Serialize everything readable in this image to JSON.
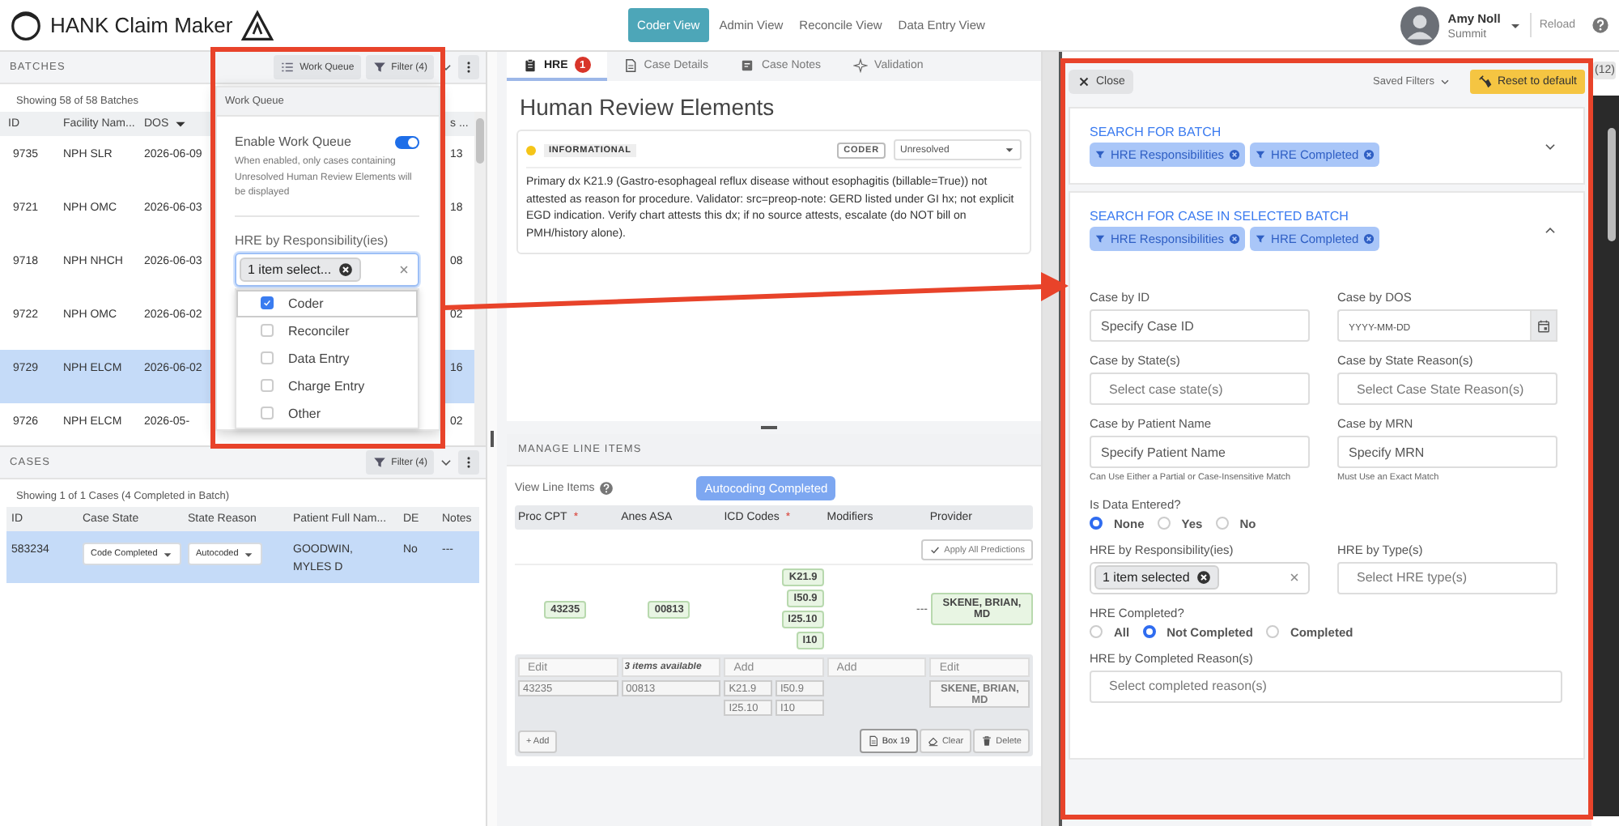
{
  "header": {
    "app_title": "HANK Claim Maker",
    "view_tabs": [
      {
        "label": "Coder View",
        "selected": true
      },
      {
        "label": "Admin View",
        "selected": false
      },
      {
        "label": "Reconcile View",
        "selected": false
      },
      {
        "label": "Data Entry View",
        "selected": false
      }
    ],
    "user": {
      "name": "Amy Noll",
      "org": "Summit"
    },
    "reload": "Reload"
  },
  "batches": {
    "title": "BATCHES",
    "work_queue_button": "Work Queue",
    "filter_button": "Filter (4)",
    "summary": "Showing 58 of 58 Batches",
    "columns": [
      "ID",
      "Facility Nam...",
      "DOS",
      "s ..."
    ],
    "rows": [
      {
        "cells": [
          "9735",
          "NPH SLR",
          "2026-06-09",
          "13"
        ],
        "selected": false
      },
      {
        "cells": [
          "9721",
          "NPH OMC",
          "2026-06-03",
          "18"
        ],
        "selected": false
      },
      {
        "cells": [
          "9718",
          "NPH NHCH",
          "2026-06-03",
          "08"
        ],
        "selected": false
      },
      {
        "cells": [
          "9722",
          "NPH OMC",
          "2026-06-02",
          "02"
        ],
        "selected": false
      },
      {
        "cells": [
          "9729",
          "NPH ELCM",
          "2026-06-02",
          "16"
        ],
        "selected": true
      },
      {
        "cells": [
          "9726",
          "NPH ELCM",
          "2026-05-",
          "02"
        ],
        "selected": false
      }
    ]
  },
  "work_queue_popup": {
    "title": "Work Queue",
    "toggle": {
      "label": "Enable Work Queue",
      "on": true
    },
    "description": "When enabled, only cases containing Unresolved Human Review Elements will be displayed",
    "responsibility": {
      "label": "HRE by Responsibility(ies)",
      "chip": "1 item select...",
      "options": [
        {
          "label": "Coder",
          "checked": true
        },
        {
          "label": "Reconciler",
          "checked": false
        },
        {
          "label": "Data Entry",
          "checked": false
        },
        {
          "label": "Charge Entry",
          "checked": false
        },
        {
          "label": "Other",
          "checked": false
        }
      ]
    }
  },
  "cases": {
    "title": "CASES",
    "filter_button": "Filter (4)",
    "summary": "Showing 1 of 1 Cases (4 Completed in Batch)",
    "columns": [
      "ID",
      "Case State",
      "State Reason",
      "Patient Full Nam...",
      "DE",
      "Notes"
    ],
    "rows": [
      {
        "id": "583234",
        "case_state": "Code Completed",
        "state_reason": "Autocoded",
        "patient": "GOODWIN, MYLES D",
        "de": "No",
        "notes": "---",
        "selected": true
      }
    ]
  },
  "case_tabs": [
    {
      "label": "HRE",
      "kind": "clipboard",
      "badge": "1",
      "selected": true
    },
    {
      "label": "Case Details",
      "kind": "document",
      "selected": false
    },
    {
      "label": "Case Notes",
      "kind": "note",
      "selected": false
    },
    {
      "label": "Validation",
      "kind": "sparkle",
      "selected": false
    }
  ],
  "hre": {
    "title": "Human Review Elements",
    "elements": [
      {
        "severity": "INFORMATIONAL",
        "color": "#f5c518",
        "responsibility": "CODER",
        "status": "Unresolved",
        "text": "Primary dx K21.9 (Gastro-esophageal reflux disease without esophagitis (billable=True)) not attested as reason for procedure. Validator: src=preop-note: GERD listed under GI hx; not explicit EGD indication. Verify chart attests this dx; if no source attests, escalate (do NOT bill on PMH/history alone)."
      }
    ]
  },
  "line_items": {
    "title": "MANAGE LINE ITEMS",
    "view_label": "View Line Items",
    "status_badge": "Autocoding Completed",
    "columns": [
      {
        "label": "Proc CPT",
        "marker": "*"
      },
      {
        "label": "Anes ASA"
      },
      {
        "label": "ICD Codes",
        "marker": "*"
      },
      {
        "label": "Modifiers"
      },
      {
        "label": "Provider"
      }
    ],
    "apply_button": "Apply All Predictions",
    "predictions": [
      {
        "chips": [
          "43235"
        ]
      },
      {
        "chips": [
          "00813"
        ]
      },
      {
        "chips": [
          "K21.9",
          "I50.9",
          "I25.10",
          "I10"
        ]
      },
      {
        "empty": "---"
      },
      {
        "chips": [
          "SKENE, BRIAN, MD"
        ]
      }
    ],
    "editors": [
      {
        "placeholder": "Edit",
        "emphasis": false,
        "values": [
          "43235"
        ]
      },
      {
        "placeholder": "3 items available",
        "emphasis": true,
        "values": [
          "00813"
        ]
      },
      {
        "placeholder": "Add",
        "emphasis": false,
        "values": [
          "K21.9",
          "I50.9",
          "I25.10",
          "I10"
        ]
      },
      {
        "placeholder": "Add",
        "emphasis": false
      },
      {
        "placeholder": "Edit",
        "emphasis": false,
        "values": [
          "SKENE, BRIAN, MD"
        ]
      }
    ],
    "add_button": "+ Add",
    "actions": [
      {
        "label": "Box 19",
        "kind": "document"
      },
      {
        "label": "Clear",
        "kind": "eraser"
      },
      {
        "label": "Delete",
        "kind": "trash"
      }
    ]
  },
  "filter_panel": {
    "close_button": "Close",
    "saved_filters": "Saved Filters",
    "reset_button": "Reset to default",
    "sections": [
      {
        "title": "SEARCH FOR BATCH",
        "expanded": false,
        "chips": [
          "HRE Responsibilities",
          "HRE Completed"
        ]
      },
      {
        "title": "SEARCH FOR CASE IN SELECTED BATCH",
        "expanded": true,
        "chips": [
          "HRE Responsibilities",
          "HRE Completed"
        ],
        "fields": [
          {
            "kind": "text",
            "label": "Case by ID",
            "placeholder": "Specify Case ID"
          },
          {
            "kind": "date",
            "label": "Case by DOS",
            "placeholder": "YYYY-MM-DD"
          },
          {
            "kind": "select",
            "label": "Case by State(s)",
            "placeholder": "Select case state(s)"
          },
          {
            "kind": "select",
            "label": "Case by State Reason(s)",
            "placeholder": "Select Case State Reason(s)"
          },
          {
            "kind": "text",
            "label": "Case by Patient Name",
            "placeholder": "Specify Patient Name",
            "hint": "Can Use Either a Partial or Case-Insensitive Match"
          },
          {
            "kind": "text",
            "label": "Case by MRN",
            "placeholder": "Specify MRN",
            "hint": "Must Use an Exact Match"
          },
          {
            "kind": "radio",
            "label": "Is Data Entered?",
            "wide": true,
            "options": [
              {
                "label": "None",
                "selected": true
              },
              {
                "label": "Yes",
                "selected": false
              },
              {
                "label": "No",
                "selected": false
              }
            ]
          },
          {
            "kind": "multiselect",
            "label": "HRE by Responsibility(ies)",
            "chip": "1 item selected"
          },
          {
            "kind": "select",
            "label": "HRE by Type(s)",
            "placeholder": "Select HRE type(s)"
          },
          {
            "kind": "radio",
            "label": "HRE Completed?",
            "wide": true,
            "options": [
              {
                "label": "All",
                "selected": false
              },
              {
                "label": "Not Completed",
                "selected": true
              },
              {
                "label": "Completed",
                "selected": false
              }
            ]
          },
          {
            "kind": "select",
            "label": "HRE by Completed Reason(s)",
            "placeholder": "Select completed reason(s)",
            "wide": true
          }
        ]
      }
    ]
  },
  "side_count": "(12)"
}
